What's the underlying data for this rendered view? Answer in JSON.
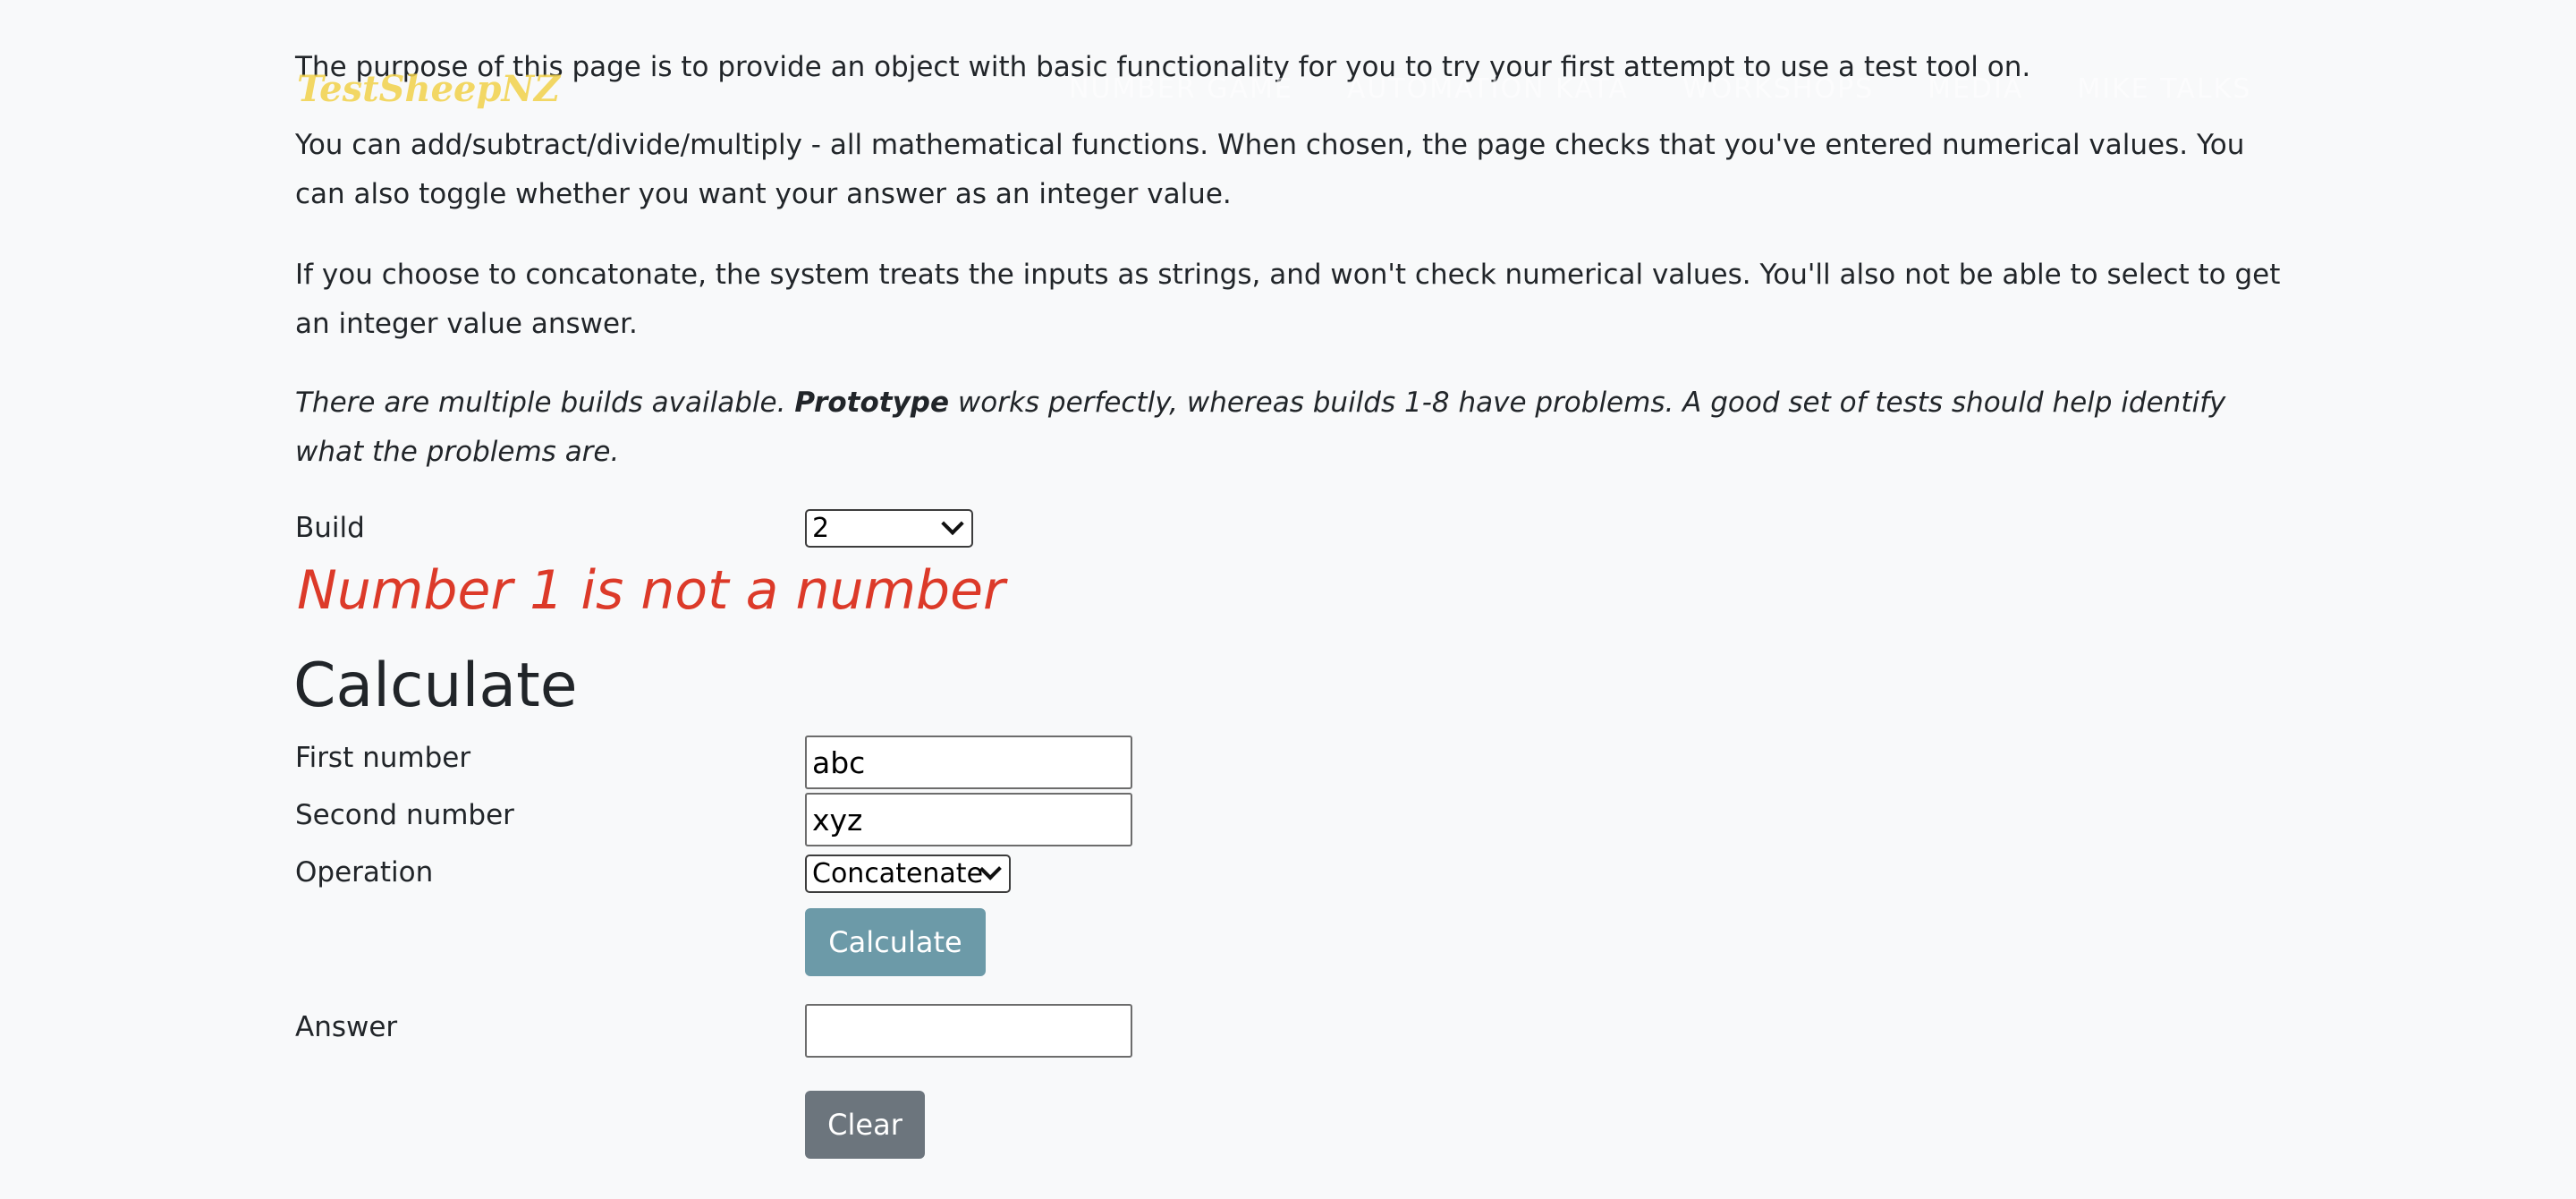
{
  "intro": {
    "paragraph1": "The purpose of this page is to provide an object with basic functionality for you to try your first attempt to use a test tool on.",
    "paragraph2": "You can add/subtract/divide/multiply - all mathematical functions. When chosen, the page checks that you've entered numerical values. You can also toggle whether you want your answer as an integer value.",
    "paragraph3": "If you choose to concatonate, the system treats the inputs as strings, and won't check numerical values. You'll also not be able to select to get an integer value answer.",
    "paragraph4_before": "There are multiple builds available. ",
    "paragraph4_bold": "Prototype",
    "paragraph4_after": " works perfectly, whereas builds 1-8 have problems. A good set of tests should help identify what the problems are."
  },
  "navbar": {
    "brand": "TestSheepNZ",
    "links": [
      "NUMBER GAME",
      "AUTOMATION KATA",
      "WORKSHOPS",
      "MEDIA",
      "MIKE TALKS"
    ]
  },
  "form": {
    "build_label": "Build",
    "build_value": "2",
    "error_message": "Number 1 is not a number",
    "heading": "Calculate",
    "first_label": "First number",
    "first_value": "abc",
    "second_label": "Second number",
    "second_value": "xyz",
    "operation_label": "Operation",
    "operation_value": "Concatenate",
    "calculate_button": "Calculate",
    "answer_label": "Answer",
    "answer_value": "",
    "clear_button": "Clear"
  },
  "colors": {
    "error": "#dc3a29",
    "calculate_button": "#6c9aa8",
    "clear_button": "#6c757d",
    "brand": "#f2d24b"
  }
}
